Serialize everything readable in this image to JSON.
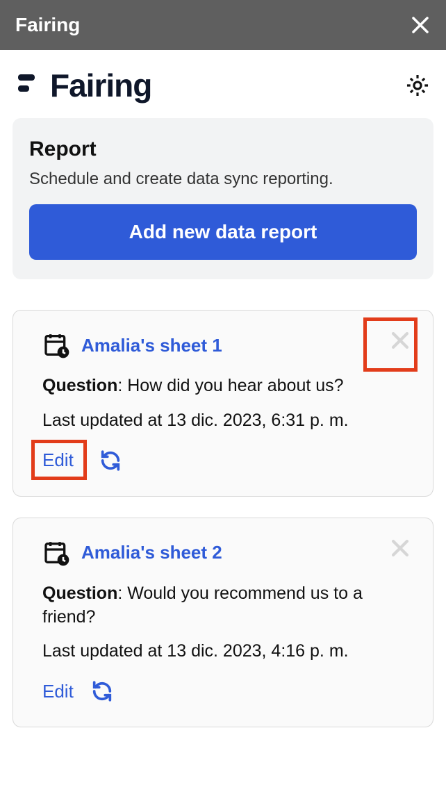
{
  "titlebar": {
    "title": "Fairing"
  },
  "brand": {
    "name": "Fairing"
  },
  "panel": {
    "title": "Report",
    "subtitle": "Schedule and create data sync reporting.",
    "button": "Add new data report"
  },
  "cards": [
    {
      "title": "Amalia's sheet 1",
      "question_label": "Question",
      "question_text": "How did you hear about us?",
      "updated": "Last updated at 13 dic. 2023, 6:31 p. m.",
      "edit": "Edit",
      "highlight_close": true,
      "highlight_edit": true
    },
    {
      "title": "Amalia's sheet 2",
      "question_label": "Question",
      "question_text": "Would you recommend us to a friend?",
      "updated": "Last updated at 13 dic. 2023, 4:16 p. m.",
      "edit": "Edit",
      "highlight_close": false,
      "highlight_edit": false
    }
  ]
}
